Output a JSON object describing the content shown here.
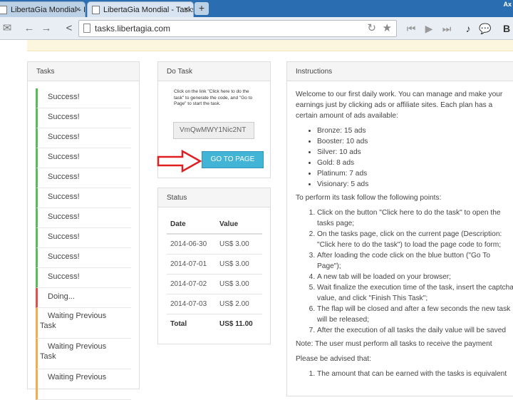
{
  "browser": {
    "tabs": [
      {
        "title": "LibertaGia Mondial - BackOf",
        "close": "×"
      },
      {
        "title": "LibertaGia Mondial - Tasks",
        "close": "×"
      }
    ],
    "new_tab": "+",
    "corner_label": "Ax",
    "url": "tasks.libertagia.com"
  },
  "tasks_panel": {
    "title": "Tasks",
    "items": [
      {
        "label": "Success!",
        "state": "success"
      },
      {
        "label": "Success!",
        "state": "success"
      },
      {
        "label": "Success!",
        "state": "success"
      },
      {
        "label": "Success!",
        "state": "success"
      },
      {
        "label": "Success!",
        "state": "success"
      },
      {
        "label": "Success!",
        "state": "success"
      },
      {
        "label": "Success!",
        "state": "success"
      },
      {
        "label": "Success!",
        "state": "success"
      },
      {
        "label": "Success!",
        "state": "success"
      },
      {
        "label": "Success!",
        "state": "success"
      },
      {
        "label": "Doing...",
        "state": "doing"
      },
      {
        "label": "Waiting Previous",
        "label2": "Task",
        "state": "waiting"
      },
      {
        "label": "Waiting Previous",
        "label2": "Task",
        "state": "waiting"
      },
      {
        "label": "Waiting Previous",
        "label2": "",
        "state": "waiting"
      }
    ]
  },
  "do_task_panel": {
    "title": "Do Task",
    "instruction": "Click on the link \"Click here to do the task\" to generate the code, and \"Go to Page\" to start the task.",
    "code_value": "VmQwMWY1Nic2NT",
    "go_button": "GO TO PAGE"
  },
  "status_panel": {
    "title": "Status",
    "headers": {
      "date": "Date",
      "value": "Value"
    },
    "rows": [
      {
        "date": "2014-06-30",
        "value": "US$ 3.00"
      },
      {
        "date": "2014-07-01",
        "value": "US$ 3.00"
      },
      {
        "date": "2014-07-02",
        "value": "US$ 3.00"
      },
      {
        "date": "2014-07-03",
        "value": "US$ 2.00"
      }
    ],
    "total_label": "Total",
    "total_value": "US$ 11.00"
  },
  "instructions_panel": {
    "title": "Instructions",
    "intro": "Welcome to our first daily work. You can manage and make your earnings just by clicking ads or affiliate sites. Each plan has a certain amount of ads available:",
    "plans": [
      "Bronze: 15 ads",
      "Booster: 10 ads",
      "Silver: 10 ads",
      "Gold: 8 ads",
      "Platinum: 7 ads",
      "Visionary: 5 ads"
    ],
    "steps_intro": "To perform its task follow the following points:",
    "steps": [
      "Click on the button \"Click here to do the task\" to open the tasks page;",
      "On the tasks page, click on the current page (Description: \"Click here to do the task\") to load the page code to form;",
      "After loading the code click on the blue button (\"Go To Page\");",
      "A new tab will be loaded on your browser;",
      "Wait finalize the execution time of the task, insert the captcha value, and click \"Finish This Task\";",
      "The flap will be closed and after a few seconds the new task will be released;",
      "After the execution of all tasks the daily value will be saved"
    ],
    "note": "Note: The user must perform all tasks to receive the payment",
    "advise": "Please be advised that:",
    "advise_item": "The amount that can be earned with the tasks is equivalent"
  },
  "colors": {
    "success": "#5cb85c",
    "doing": "#d9534f",
    "waiting": "#f0ad4e",
    "go_button": "#42b4d6",
    "arrow": "#e02020"
  }
}
